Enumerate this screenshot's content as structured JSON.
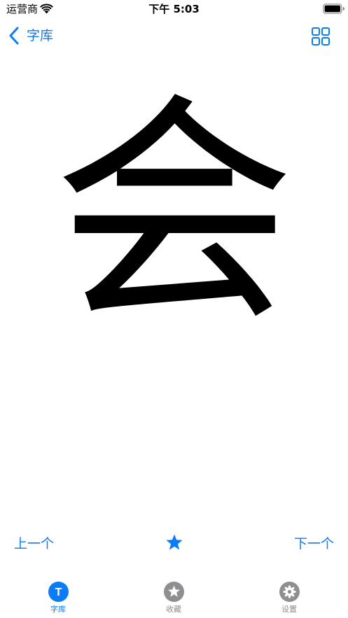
{
  "status_bar": {
    "carrier": "运营商",
    "time": "下午 5:03"
  },
  "nav": {
    "back_label": "字库",
    "grid_icon": "grid-icon"
  },
  "main": {
    "character": "会"
  },
  "actions": {
    "prev_label": "上一个",
    "next_label": "下一个",
    "favorite_icon": "star-icon"
  },
  "tab_bar": {
    "tabs": [
      {
        "label": "字库",
        "icon": "font-icon",
        "icon_text": "T",
        "active": true
      },
      {
        "label": "收藏",
        "icon": "star-icon",
        "active": false
      },
      {
        "label": "设置",
        "icon": "gear-icon",
        "active": false
      }
    ]
  },
  "colors": {
    "accent": "#0a7cf7",
    "inactive": "#8e8e93",
    "text": "#000000",
    "background": "#ffffff"
  }
}
